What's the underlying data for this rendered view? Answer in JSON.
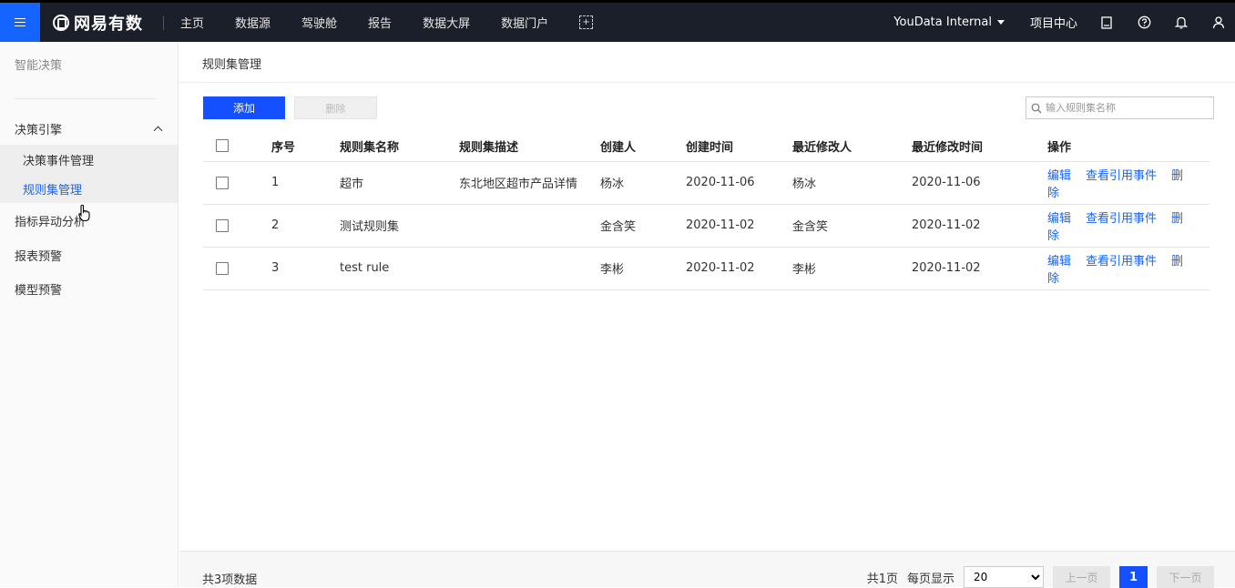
{
  "topbar": {
    "brand": "网易有数",
    "nav": [
      "主页",
      "数据源",
      "驾驶舱",
      "报告",
      "数据大屏",
      "数据门户"
    ],
    "workspace": "YouData Internal",
    "project_center": "项目中心",
    "icons": [
      "menu-icon",
      "expand-icon",
      "book-icon",
      "help-icon",
      "bell-icon",
      "user-icon"
    ]
  },
  "sidebar": {
    "title": "智能决策",
    "group": "决策引擎",
    "sub_items": [
      "决策事件管理",
      "规则集管理"
    ],
    "items": [
      "指标异动分析",
      "报表预警",
      "模型预警"
    ]
  },
  "main": {
    "breadcrumb": "规则集管理",
    "add_label": "添加",
    "delete_label": "删除",
    "search_placeholder": "输入规则集名称",
    "columns": [
      "序号",
      "规则集名称",
      "规则集描述",
      "创建人",
      "创建时间",
      "最近修改人",
      "最近修改时间",
      "操作"
    ],
    "rows": [
      {
        "no": "1",
        "name": "超市",
        "desc": "东北地区超市产品详情",
        "creator": "杨冰",
        "created": "2020-11-06",
        "modifier": "杨冰",
        "modified": "2020-11-06"
      },
      {
        "no": "2",
        "name": "测试规则集",
        "desc": "",
        "creator": "金含笑",
        "created": "2020-11-02",
        "modifier": "金含笑",
        "modified": "2020-11-02"
      },
      {
        "no": "3",
        "name": "test rule",
        "desc": "",
        "creator": "李彬",
        "created": "2020-11-02",
        "modifier": "李彬",
        "modified": "2020-11-02"
      }
    ],
    "ops": [
      "编辑",
      "查看引用事件",
      "删除"
    ]
  },
  "footer": {
    "total": "共3项数据",
    "pages": "共1页",
    "per_page_label": "每页显示",
    "page_size": "20",
    "prev": "上一页",
    "current_page": "1",
    "next": "下一页"
  },
  "colors": {
    "accent": "#1450ff",
    "link": "#1664ff",
    "topbar": "#1b1f2a"
  }
}
